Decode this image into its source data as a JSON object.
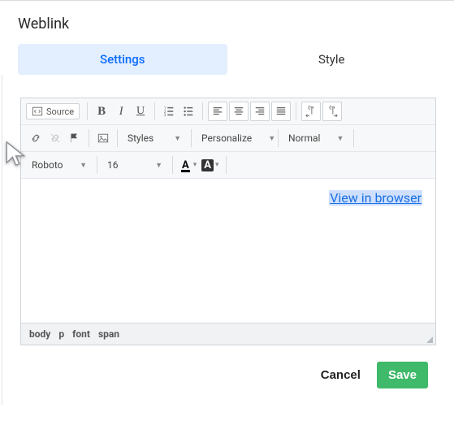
{
  "title": "Weblink",
  "tabs": {
    "settings": "Settings",
    "style": "Style"
  },
  "toolbar": {
    "source": "Source",
    "styles": "Styles",
    "personalize": "Personalize",
    "format": "Normal",
    "font": "Roboto",
    "size": "16"
  },
  "content": {
    "link_text": "View in browser"
  },
  "path": {
    "p0": "body",
    "p1": "p",
    "p2": "font",
    "p3": "span"
  },
  "actions": {
    "cancel": "Cancel",
    "save": "Save"
  }
}
